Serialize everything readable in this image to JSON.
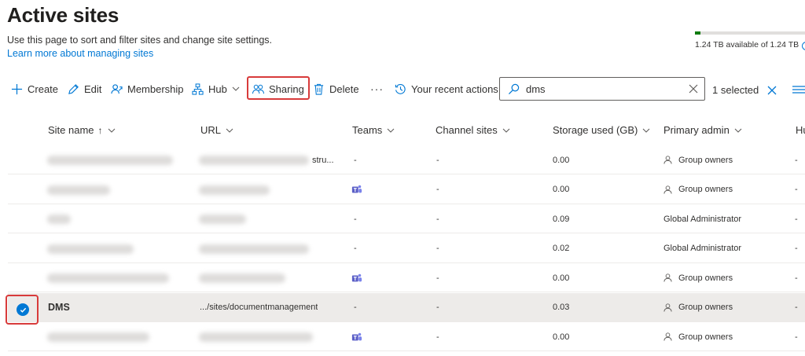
{
  "page": {
    "title": "Active sites",
    "description": "Use this page to sort and filter sites and change site settings.",
    "learn_more": "Learn more about managing sites"
  },
  "storage": {
    "text": "1.24 TB available of 1.24 TB",
    "used_fraction": 0.05,
    "info_glyph": "i"
  },
  "toolbar": {
    "create": "Create",
    "edit": "Edit",
    "membership": "Membership",
    "hub": "Hub",
    "sharing": "Sharing",
    "delete": "Delete",
    "more": "···",
    "recent_actions": "Your recent actions"
  },
  "search": {
    "value": "dms"
  },
  "selection": {
    "count_text": "1 selected"
  },
  "columns": {
    "site_name": "Site name",
    "sort_arrow": "↑",
    "url": "URL",
    "teams": "Teams",
    "channel_sites": "Channel sites",
    "storage_used": "Storage used (GB)",
    "primary_admin": "Primary admin",
    "hub_partial": "Hu"
  },
  "rows": [
    {
      "name": "",
      "url": "stru...",
      "teams": "-",
      "channel": "-",
      "storage": "0.00",
      "admin": "Group owners",
      "admin_icon": "person-icon",
      "hub": "-"
    },
    {
      "name": "",
      "url": "",
      "teams": "",
      "teams_icon": "teams-icon",
      "channel": "-",
      "storage": "0.00",
      "admin": "Group owners",
      "admin_icon": "person-icon",
      "hub": "-"
    },
    {
      "name": "",
      "url": "",
      "teams": "-",
      "channel": "-",
      "storage": "0.09",
      "admin": "Global Administrator",
      "hub": "-"
    },
    {
      "name": "",
      "url": "",
      "teams": "-",
      "channel": "-",
      "storage": "0.02",
      "admin": "Global Administrator",
      "hub": "-"
    },
    {
      "name": "",
      "url": "",
      "teams": "",
      "teams_icon": "teams-icon",
      "channel": "-",
      "storage": "0.00",
      "admin": "Group owners",
      "admin_icon": "person-icon",
      "hub": "-"
    },
    {
      "name": "DMS",
      "url": ".../sites/documentmanagement",
      "teams": "-",
      "channel": "-",
      "storage": "0.03",
      "admin": "Group owners",
      "admin_icon": "person-icon",
      "hub": "-",
      "selected": true
    },
    {
      "name": "",
      "url": "",
      "teams": "",
      "teams_icon": "teams-icon",
      "channel": "-",
      "storage": "0.00",
      "admin": "Group owners",
      "admin_icon": "person-icon",
      "hub": "-"
    }
  ],
  "colors": {
    "accent": "#0078d4",
    "highlight": "#d83b3b",
    "storage_fill": "#107c10"
  }
}
